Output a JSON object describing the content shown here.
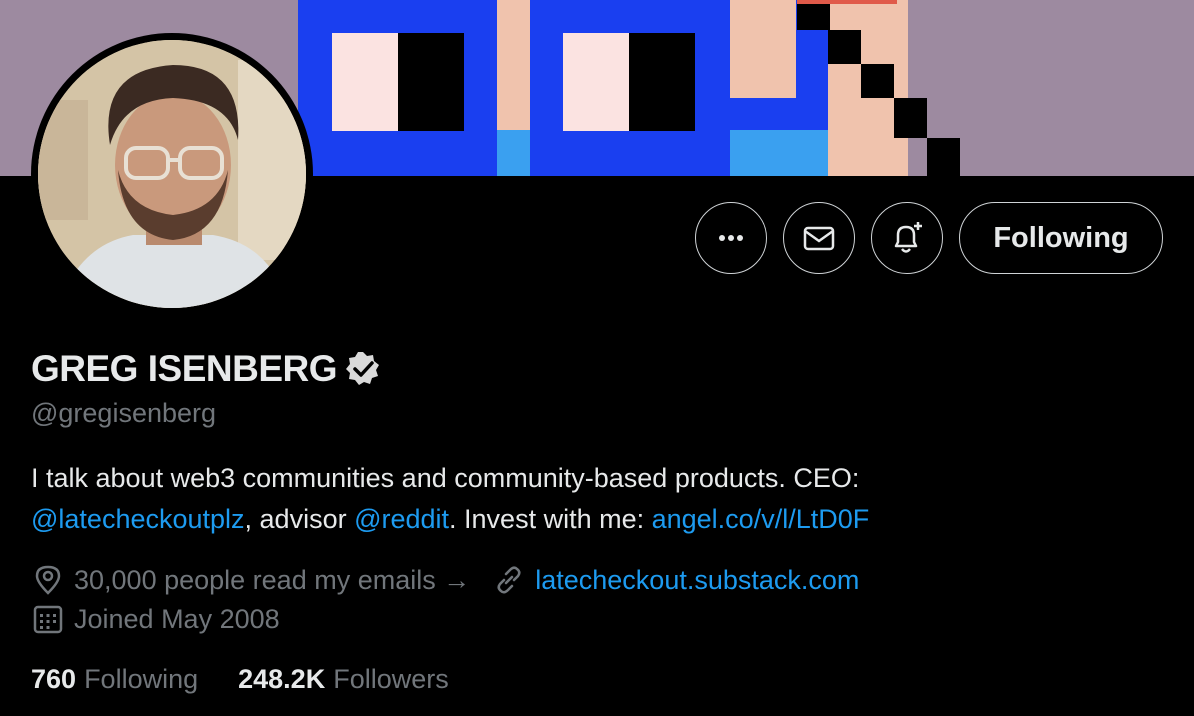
{
  "profile": {
    "display_name": "GREG ISENBERG",
    "handle": "@gregisenberg",
    "verified": true,
    "avatar_alt": "profile photo"
  },
  "actions": {
    "more_icon": "more-horizontal-icon",
    "message_icon": "envelope-icon",
    "notify_icon": "bell-plus-icon",
    "follow_label": "Following"
  },
  "bio": {
    "line1": "I talk about web3 communities and community-based products. CEO:",
    "mention1": "@latecheckoutplz",
    "text2": ", advisor ",
    "mention2": "@reddit",
    "text3": ". Invest with me: ",
    "link": "angel.co/v/l/LtD0F"
  },
  "meta": {
    "location": "30,000 people read my emails →",
    "website": "latecheckout.substack.com",
    "joined": "Joined May 2008"
  },
  "stats": {
    "following_count": "760",
    "following_label": "Following",
    "followers_count": "248.2K",
    "followers_label": "Followers"
  },
  "colors": {
    "accent": "#1d9bf0",
    "banner_bg": "#9d8aa0",
    "text_secondary": "#71767b"
  }
}
